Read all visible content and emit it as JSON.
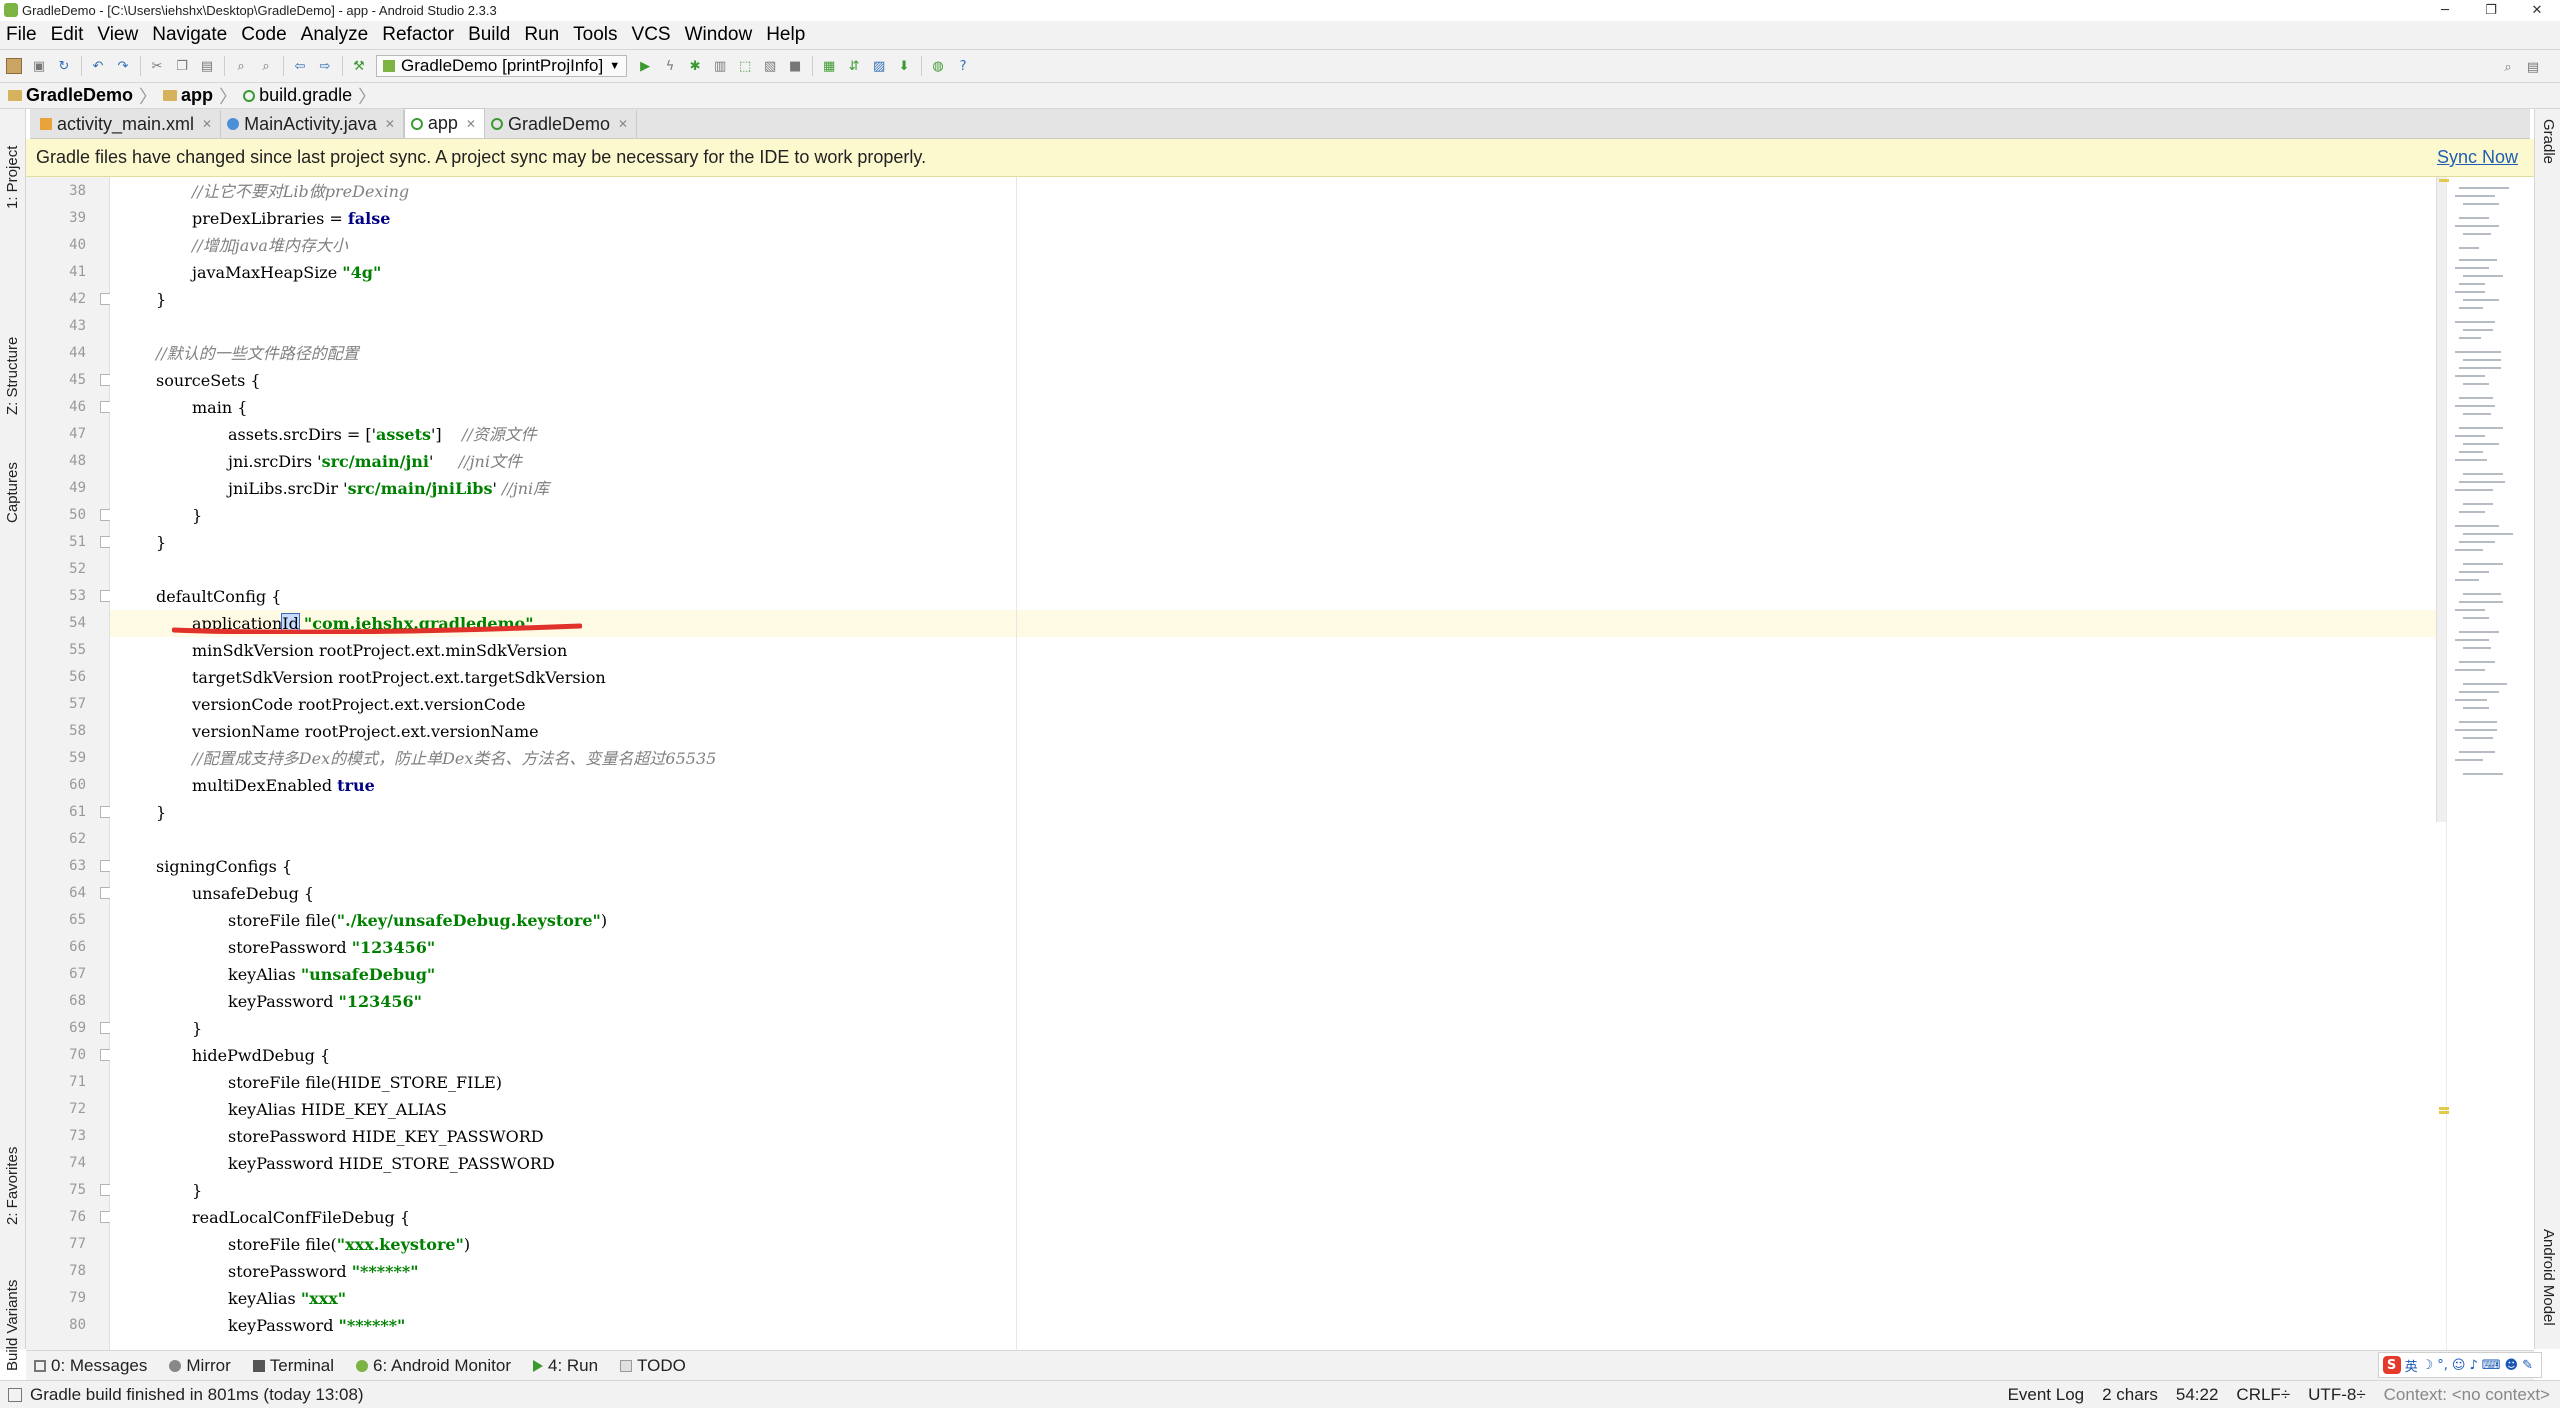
{
  "window": {
    "title": "GradleDemo - [C:\\Users\\iehshx\\Desktop\\GradleDemo] - app - Android Studio 2.3.3",
    "minimize": "─",
    "maximize": "❐",
    "close": "✕"
  },
  "menu": [
    "File",
    "Edit",
    "View",
    "Navigate",
    "Code",
    "Analyze",
    "Refactor",
    "Build",
    "Run",
    "Tools",
    "VCS",
    "Window",
    "Help"
  ],
  "toolbar": {
    "run_config": "GradleDemo [printProjInfo]"
  },
  "breadcrumb": [
    "GradleDemo",
    "app",
    "build.gradle"
  ],
  "tabs": [
    {
      "label": "activity_main.xml",
      "kind": "xml"
    },
    {
      "label": "MainActivity.java",
      "kind": "java"
    },
    {
      "label": "app",
      "kind": "gradle",
      "active": true
    },
    {
      "label": "GradleDemo",
      "kind": "gradle"
    }
  ],
  "left_tool_tabs": [
    "1: Project",
    "Z: Structure",
    "Captures",
    "2: Favorites",
    "Build Variants"
  ],
  "right_tool_tabs": [
    "Gradle",
    "Android Model"
  ],
  "banner": {
    "message": "Gradle files have changed since last project sync. A project sync may be necessary for the IDE to work properly.",
    "action": "Sync Now"
  },
  "code_lines": [
    {
      "n": "38",
      "indent": 2,
      "segs": [
        [
          "c",
          "//让它不要对Lib做preDexing"
        ]
      ]
    },
    {
      "n": "39",
      "indent": 2,
      "segs": [
        [
          "p",
          "preDexLibraries = "
        ],
        [
          "k",
          "false"
        ]
      ]
    },
    {
      "n": "40",
      "indent": 2,
      "segs": [
        [
          "c",
          "//增加java堆内存大小"
        ]
      ]
    },
    {
      "n": "41",
      "indent": 2,
      "segs": [
        [
          "p",
          "javaMaxHeapSize "
        ],
        [
          "s",
          "\"4g\""
        ]
      ]
    },
    {
      "n": "42",
      "indent": 1,
      "segs": [
        [
          "p",
          "}"
        ]
      ],
      "fold": true
    },
    {
      "n": "43",
      "indent": 0,
      "segs": []
    },
    {
      "n": "44",
      "indent": 1,
      "segs": [
        [
          "c",
          "//默认的一些文件路径的配置"
        ]
      ]
    },
    {
      "n": "45",
      "indent": 1,
      "segs": [
        [
          "p",
          "sourceSets {"
        ]
      ],
      "fold": true
    },
    {
      "n": "46",
      "indent": 2,
      "segs": [
        [
          "p",
          "main {"
        ]
      ],
      "fold": true
    },
    {
      "n": "47",
      "indent": 3,
      "segs": [
        [
          "p",
          "assets.srcDirs = ['"
        ],
        [
          "s",
          "assets"
        ],
        [
          "p",
          "']    "
        ],
        [
          "c",
          "//资源文件"
        ]
      ]
    },
    {
      "n": "48",
      "indent": 3,
      "segs": [
        [
          "p",
          "jni.srcDirs '"
        ],
        [
          "s",
          "src/main/jni"
        ],
        [
          "p",
          "'     "
        ],
        [
          "c",
          "//jni文件"
        ]
      ]
    },
    {
      "n": "49",
      "indent": 3,
      "segs": [
        [
          "p",
          "jniLibs.srcDir '"
        ],
        [
          "s",
          "src/main/jniLibs"
        ],
        [
          "p",
          "' "
        ],
        [
          "c",
          "//jni库"
        ]
      ]
    },
    {
      "n": "50",
      "indent": 2,
      "segs": [
        [
          "p",
          "}"
        ]
      ],
      "fold": true
    },
    {
      "n": "51",
      "indent": 1,
      "segs": [
        [
          "p",
          "}"
        ]
      ],
      "fold": true
    },
    {
      "n": "52",
      "indent": 0,
      "segs": []
    },
    {
      "n": "53",
      "indent": 1,
      "segs": [
        [
          "p",
          "defaultConfig {"
        ]
      ],
      "fold": true
    },
    {
      "n": "54",
      "indent": 2,
      "segs": [
        [
          "p",
          "application"
        ],
        [
          "sel",
          "Id"
        ],
        [
          "p",
          " "
        ],
        [
          "s",
          "\"com.iehshx.gradledemo\""
        ]
      ],
      "current": true,
      "bulb": true
    },
    {
      "n": "55",
      "indent": 2,
      "segs": [
        [
          "p",
          "minSdkVersion rootProject.ext.minSdkVersion"
        ]
      ]
    },
    {
      "n": "56",
      "indent": 2,
      "segs": [
        [
          "p",
          "targetSdkVersion rootProject.ext.targetSdkVersion"
        ]
      ]
    },
    {
      "n": "57",
      "indent": 2,
      "segs": [
        [
          "p",
          "versionCode rootProject.ext.versionCode"
        ]
      ]
    },
    {
      "n": "58",
      "indent": 2,
      "segs": [
        [
          "p",
          "versionName rootProject.ext.versionName"
        ]
      ]
    },
    {
      "n": "59",
      "indent": 2,
      "segs": [
        [
          "c",
          "//配置成支持多Dex的模式，防止单Dex类名、方法名、变量名超过65535"
        ]
      ]
    },
    {
      "n": "60",
      "indent": 2,
      "segs": [
        [
          "p",
          "multiDexEnabled "
        ],
        [
          "k",
          "true"
        ]
      ]
    },
    {
      "n": "61",
      "indent": 1,
      "segs": [
        [
          "p",
          "}"
        ]
      ],
      "fold": true
    },
    {
      "n": "62",
      "indent": 0,
      "segs": []
    },
    {
      "n": "63",
      "indent": 1,
      "segs": [
        [
          "p",
          "signingConfigs {"
        ]
      ],
      "fold": true
    },
    {
      "n": "64",
      "indent": 2,
      "segs": [
        [
          "p",
          "unsafeDebug {"
        ]
      ],
      "fold": true
    },
    {
      "n": "65",
      "indent": 3,
      "segs": [
        [
          "p",
          "storeFile file("
        ],
        [
          "s",
          "\"./key/unsafeDebug.keystore\""
        ],
        [
          "p",
          ")"
        ]
      ]
    },
    {
      "n": "66",
      "indent": 3,
      "segs": [
        [
          "p",
          "storePassword "
        ],
        [
          "s",
          "\"123456\""
        ]
      ]
    },
    {
      "n": "67",
      "indent": 3,
      "segs": [
        [
          "p",
          "keyAlias "
        ],
        [
          "s",
          "\"unsafeDebug\""
        ]
      ]
    },
    {
      "n": "68",
      "indent": 3,
      "segs": [
        [
          "p",
          "keyPassword "
        ],
        [
          "s",
          "\"123456\""
        ]
      ]
    },
    {
      "n": "69",
      "indent": 2,
      "segs": [
        [
          "p",
          "}"
        ]
      ],
      "fold": true
    },
    {
      "n": "70",
      "indent": 2,
      "segs": [
        [
          "p",
          "hidePwdDebug {"
        ]
      ],
      "fold": true
    },
    {
      "n": "71",
      "indent": 3,
      "segs": [
        [
          "p",
          "storeFile file(HIDE_STORE_FILE)"
        ]
      ]
    },
    {
      "n": "72",
      "indent": 3,
      "segs": [
        [
          "p",
          "keyAlias HIDE_KEY_ALIAS"
        ]
      ]
    },
    {
      "n": "73",
      "indent": 3,
      "segs": [
        [
          "p",
          "storePassword HIDE_KEY_PASSWORD"
        ]
      ]
    },
    {
      "n": "74",
      "indent": 3,
      "segs": [
        [
          "p",
          "keyPassword HIDE_STORE_PASSWORD"
        ]
      ]
    },
    {
      "n": "75",
      "indent": 2,
      "segs": [
        [
          "p",
          "}"
        ]
      ],
      "fold": true
    },
    {
      "n": "76",
      "indent": 2,
      "segs": [
        [
          "p",
          "readLocalConfFileDebug {"
        ]
      ],
      "fold": true
    },
    {
      "n": "77",
      "indent": 3,
      "segs": [
        [
          "p",
          "storeFile file("
        ],
        [
          "s",
          "\"xxx.keystore\""
        ],
        [
          "p",
          ")"
        ]
      ]
    },
    {
      "n": "78",
      "indent": 3,
      "segs": [
        [
          "p",
          "storePassword "
        ],
        [
          "s",
          "\"******\""
        ]
      ]
    },
    {
      "n": "79",
      "indent": 3,
      "segs": [
        [
          "p",
          "keyAlias "
        ],
        [
          "s",
          "\"xxx\""
        ]
      ]
    },
    {
      "n": "80",
      "indent": 3,
      "segs": [
        [
          "p",
          "keyPassword "
        ],
        [
          "s",
          "\"******\""
        ]
      ]
    }
  ],
  "tool_windows": [
    {
      "label": "0: Messages",
      "icon": "messages-icon"
    },
    {
      "label": "Mirror",
      "icon": "mirror-icon"
    },
    {
      "label": "Terminal",
      "icon": "terminal-icon"
    },
    {
      "label": "6: Android Monitor",
      "icon": "android-icon"
    },
    {
      "label": "4: Run",
      "icon": "run-icon"
    },
    {
      "label": "TODO",
      "icon": "todo-icon"
    }
  ],
  "status": {
    "message": "Gradle build finished in 801ms (today 13:08)",
    "chars": "2 chars",
    "position": "54:22",
    "line_sep": "CRLF÷",
    "encoding": "UTF-8÷",
    "context": "Context: <no context>",
    "event_log": "Event Log"
  },
  "ime": {
    "logo": "S",
    "lang": "英"
  },
  "colors": {
    "comment": "#808080",
    "keyword": "#000080",
    "string": "#008000",
    "annotation": "#e0312a",
    "banner": "#fdf9cf"
  }
}
